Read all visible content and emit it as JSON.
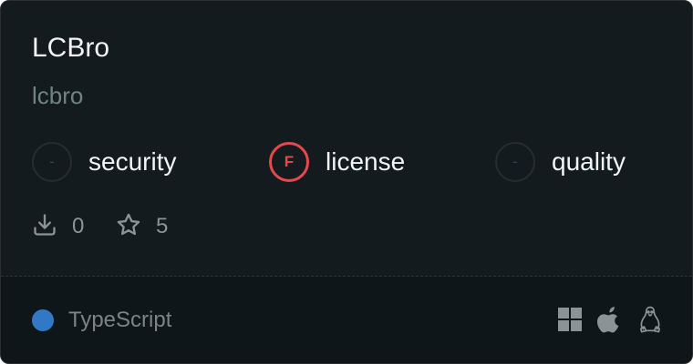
{
  "package": {
    "title": "LCBro",
    "name": "lcbro"
  },
  "scores": [
    {
      "grade": "-",
      "label": "security",
      "status": "none"
    },
    {
      "grade": "F",
      "label": "license",
      "status": "fail"
    },
    {
      "grade": "-",
      "label": "quality",
      "status": "none"
    }
  ],
  "stats": {
    "downloads": "0",
    "stars": "5"
  },
  "language": {
    "name": "TypeScript",
    "color": "#3178c6"
  },
  "platforms": [
    "windows-icon",
    "apple-icon",
    "linux-icon"
  ],
  "colors": {
    "fail": "#e5484d",
    "card_bg": "#141b1f"
  }
}
